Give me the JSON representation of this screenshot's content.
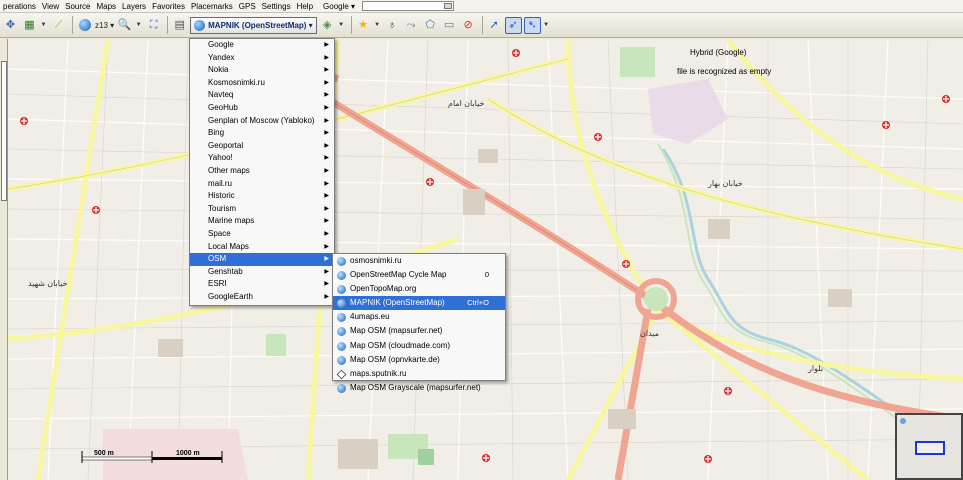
{
  "menubar": {
    "items": [
      "perations",
      "View",
      "Source",
      "Maps",
      "Layers",
      "Favorites",
      "Placemarks",
      "GPS",
      "Settings",
      "Help"
    ],
    "search_provider": "Google ▾"
  },
  "toolbar": {
    "zoom_label": "z13 ▾",
    "map_type": "MAPNIK (OpenStreetMap) ▾"
  },
  "main_menu": {
    "items": [
      {
        "label": "Google",
        "submenu": true
      },
      {
        "label": "Yandex",
        "submenu": true
      },
      {
        "label": "Nokia",
        "submenu": true
      },
      {
        "label": "Kosmosnimki.ru",
        "submenu": true
      },
      {
        "label": "Navteq",
        "submenu": true
      },
      {
        "label": "GeoHub",
        "submenu": true
      },
      {
        "label": "Genplan of Moscow (Yabloko)",
        "submenu": true
      },
      {
        "label": "Bing",
        "submenu": true
      },
      {
        "label": "Geoportal",
        "submenu": true
      },
      {
        "label": "Yahoo!",
        "submenu": true
      },
      {
        "label": "Other maps",
        "submenu": true
      },
      {
        "label": "mail.ru",
        "submenu": true
      },
      {
        "label": "Historic",
        "submenu": true
      },
      {
        "label": "Tourism",
        "submenu": true
      },
      {
        "label": "Marine maps",
        "submenu": true
      },
      {
        "label": "Space",
        "submenu": true
      },
      {
        "label": "Local Maps",
        "submenu": true
      },
      {
        "label": "OSM",
        "submenu": true,
        "highlighted": true
      },
      {
        "label": "Genshtab",
        "submenu": true
      },
      {
        "label": "ESRI",
        "submenu": true
      },
      {
        "label": "GoogleEarth",
        "submenu": true
      }
    ]
  },
  "osm_menu": {
    "items": [
      {
        "label": "osmosnimki.ru",
        "shortcut": "",
        "icon": "globe-icon"
      },
      {
        "label": "OpenStreetMap Cycle Map",
        "shortcut": "0",
        "icon": "globe-icon"
      },
      {
        "label": "OpenTopoMap.org",
        "shortcut": "",
        "icon": "globe-icon"
      },
      {
        "label": "MAPNIK (OpenStreetMap)",
        "shortcut": "Ctrl+O",
        "icon": "globe-icon",
        "highlighted": true
      },
      {
        "label": "4umaps.eu",
        "shortcut": "",
        "icon": "globe-icon"
      },
      {
        "label": "Map OSM (mapsurfer.net)",
        "shortcut": "",
        "icon": "globe-icon"
      },
      {
        "label": "Map OSM (cloudmade.com)",
        "shortcut": "",
        "icon": "globe-icon"
      },
      {
        "label": "Map OSM (opnvkarte.de)",
        "shortcut": "",
        "icon": "globe-icon"
      },
      {
        "label": "maps.sputnik.ru",
        "shortcut": "",
        "icon": "diamond-icon"
      },
      {
        "label": "Map OSM Grayscale (mapsurfer.net)",
        "shortcut": "",
        "icon": "globe-icon"
      }
    ]
  },
  "map": {
    "hybrid_label": "Hybrid (Google)",
    "recognized_label": "file is recognized as empty",
    "scale_labels": [
      "500 m",
      "1000 m"
    ],
    "street_labels": [
      "خیابان امام",
      "خیابان بهار",
      "بلوار",
      "میدان",
      "خیابان شهید"
    ],
    "colors": {
      "primary_road": "#f0a592",
      "secondary_road": "#f9f6a0",
      "park": "#c7e6bb",
      "water": "#aad3df",
      "land": "#f1eee8"
    }
  }
}
